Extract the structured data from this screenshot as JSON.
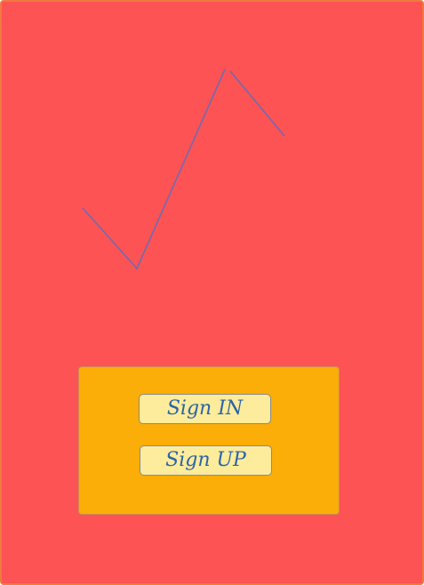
{
  "colors": {
    "background": "#fd5354",
    "screen_border": "#f07a3e",
    "logo_stroke": "#6f6bb1",
    "panel": "#fbad08",
    "button_fill": "#fdec9b",
    "button_text": "#2a64a8"
  },
  "logo": {
    "icon": "checkmark-zigzag-logo"
  },
  "auth": {
    "sign_in_label": "Sign IN",
    "sign_up_label": "Sign UP"
  }
}
